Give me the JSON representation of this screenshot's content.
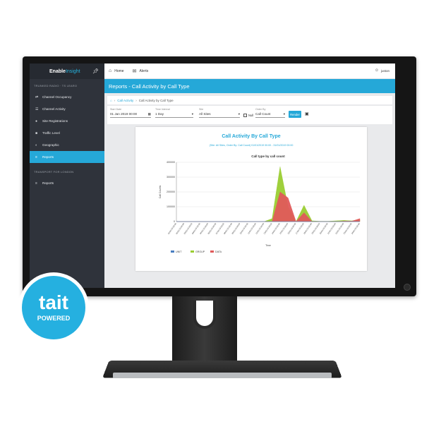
{
  "app": {
    "brand_bold": "Enable",
    "brand_thin": "Insight"
  },
  "sidebar": {
    "section1": "TRUNKED RADIO · TS LEARO",
    "items": [
      {
        "label": "Channel Occupancy",
        "icon": "occupancy-icon"
      },
      {
        "label": "Channel Activity",
        "icon": "activity-icon"
      },
      {
        "label": "Site Registrations",
        "icon": "registrations-icon"
      },
      {
        "label": "Traffic Level",
        "icon": "traffic-icon"
      },
      {
        "label": "Geographic",
        "icon": "globe-icon"
      },
      {
        "label": "Reports",
        "icon": "reports-icon"
      }
    ],
    "section2": "TRANSPORT FOR LONDON",
    "items2": [
      {
        "label": "Reports",
        "icon": "reports-icon"
      }
    ]
  },
  "topbar": {
    "home": "Home",
    "alerts": "Alerts",
    "user": "juston"
  },
  "page": {
    "title": "Reports - Call Activity by Call Type"
  },
  "breadcrumb": {
    "parent": "Call Activity",
    "current": "Call Activity by Call Type"
  },
  "filters": {
    "start_label": "Start Date",
    "start_value": "01 Jan 2019 00:00",
    "period_label": "Time Interval",
    "period_value": "1 Day",
    "site_label": "Site",
    "site_value": "All Sites",
    "null_label": "Null",
    "order_label": "Order By",
    "order_value": "Call Count",
    "render_label": "Render"
  },
  "report": {
    "title": "Call Activity By Call Type",
    "subtitle": "(Site: All Sites, Order By: Call Count) 01/01/2019 00:00 - 31/01/2019 00:00"
  },
  "chart_data": {
    "type": "area",
    "title": "Call type by call count",
    "xlabel": "Time",
    "ylabel": "Call Counts",
    "ylim": [
      0,
      400000
    ],
    "yticks": [
      0,
      100000,
      200000,
      300000,
      400000
    ],
    "grid": true,
    "legend": "bottom-left",
    "x": [
      "01/01/19 00:00",
      "02/01/19 00:00",
      "03/01/19 00:00",
      "04/01/19 00:00",
      "05/01/19 00:00",
      "06/01/19 00:00",
      "07/01/19 00:00",
      "08/01/19 00:00",
      "09/01/19 00:00",
      "10/01/19 00:00",
      "11/01/19 00:00",
      "12/01/19 00:00",
      "13/01/19 00:00",
      "14/01/19 00:00",
      "15/01/19 00:00",
      "16/01/19 00:00",
      "17/01/19 00:00",
      "18/01/19 00:00",
      "19/01/19 00:00",
      "20/01/19 00:00",
      "21/01/19 00:00",
      "22/01/19 00:00",
      "23/01/19 00:00",
      "24/01/19 00:00"
    ],
    "series": [
      {
        "name": "UNIT",
        "color": "#4a7fc0",
        "values": [
          0,
          0,
          0,
          0,
          0,
          0,
          0,
          0,
          0,
          0,
          0,
          0,
          0,
          0,
          0,
          0,
          0,
          0,
          0,
          0,
          0,
          0,
          0,
          0
        ]
      },
      {
        "name": "GROUP",
        "color": "#9acd32",
        "values": [
          0,
          0,
          0,
          0,
          0,
          0,
          0,
          0,
          0,
          0,
          0,
          0,
          20000,
          370000,
          100000,
          0,
          110000,
          5000,
          2000,
          2000,
          5000,
          8000,
          5000,
          12000
        ]
      },
      {
        "name": "DATA",
        "color": "#e05a5a",
        "values": [
          0,
          0,
          0,
          0,
          0,
          0,
          0,
          0,
          0,
          0,
          0,
          0,
          0,
          200000,
          160000,
          0,
          60000,
          0,
          0,
          0,
          0,
          3000,
          3000,
          20000
        ]
      }
    ]
  }
}
